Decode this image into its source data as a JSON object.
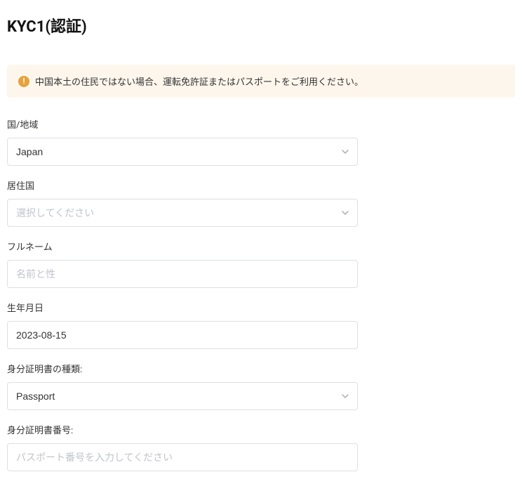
{
  "title": "KYC1(認証)",
  "alert": {
    "text": "中国本土の住民ではない場合、運転免許証またはパスポートをご利用ください。"
  },
  "form": {
    "country": {
      "label": "国/地域",
      "value": "Japan"
    },
    "residence": {
      "label": "居住国",
      "value": "選択してください"
    },
    "fullname": {
      "label": "フルネーム",
      "placeholder": "名前と性"
    },
    "birthdate": {
      "label": "生年月日",
      "value": "2023-08-15"
    },
    "id_type": {
      "label": "身分証明書の種類:",
      "value": "Passport"
    },
    "id_number": {
      "label": "身分証明書番号:",
      "placeholder": "パスポート番号を入力してください"
    }
  }
}
